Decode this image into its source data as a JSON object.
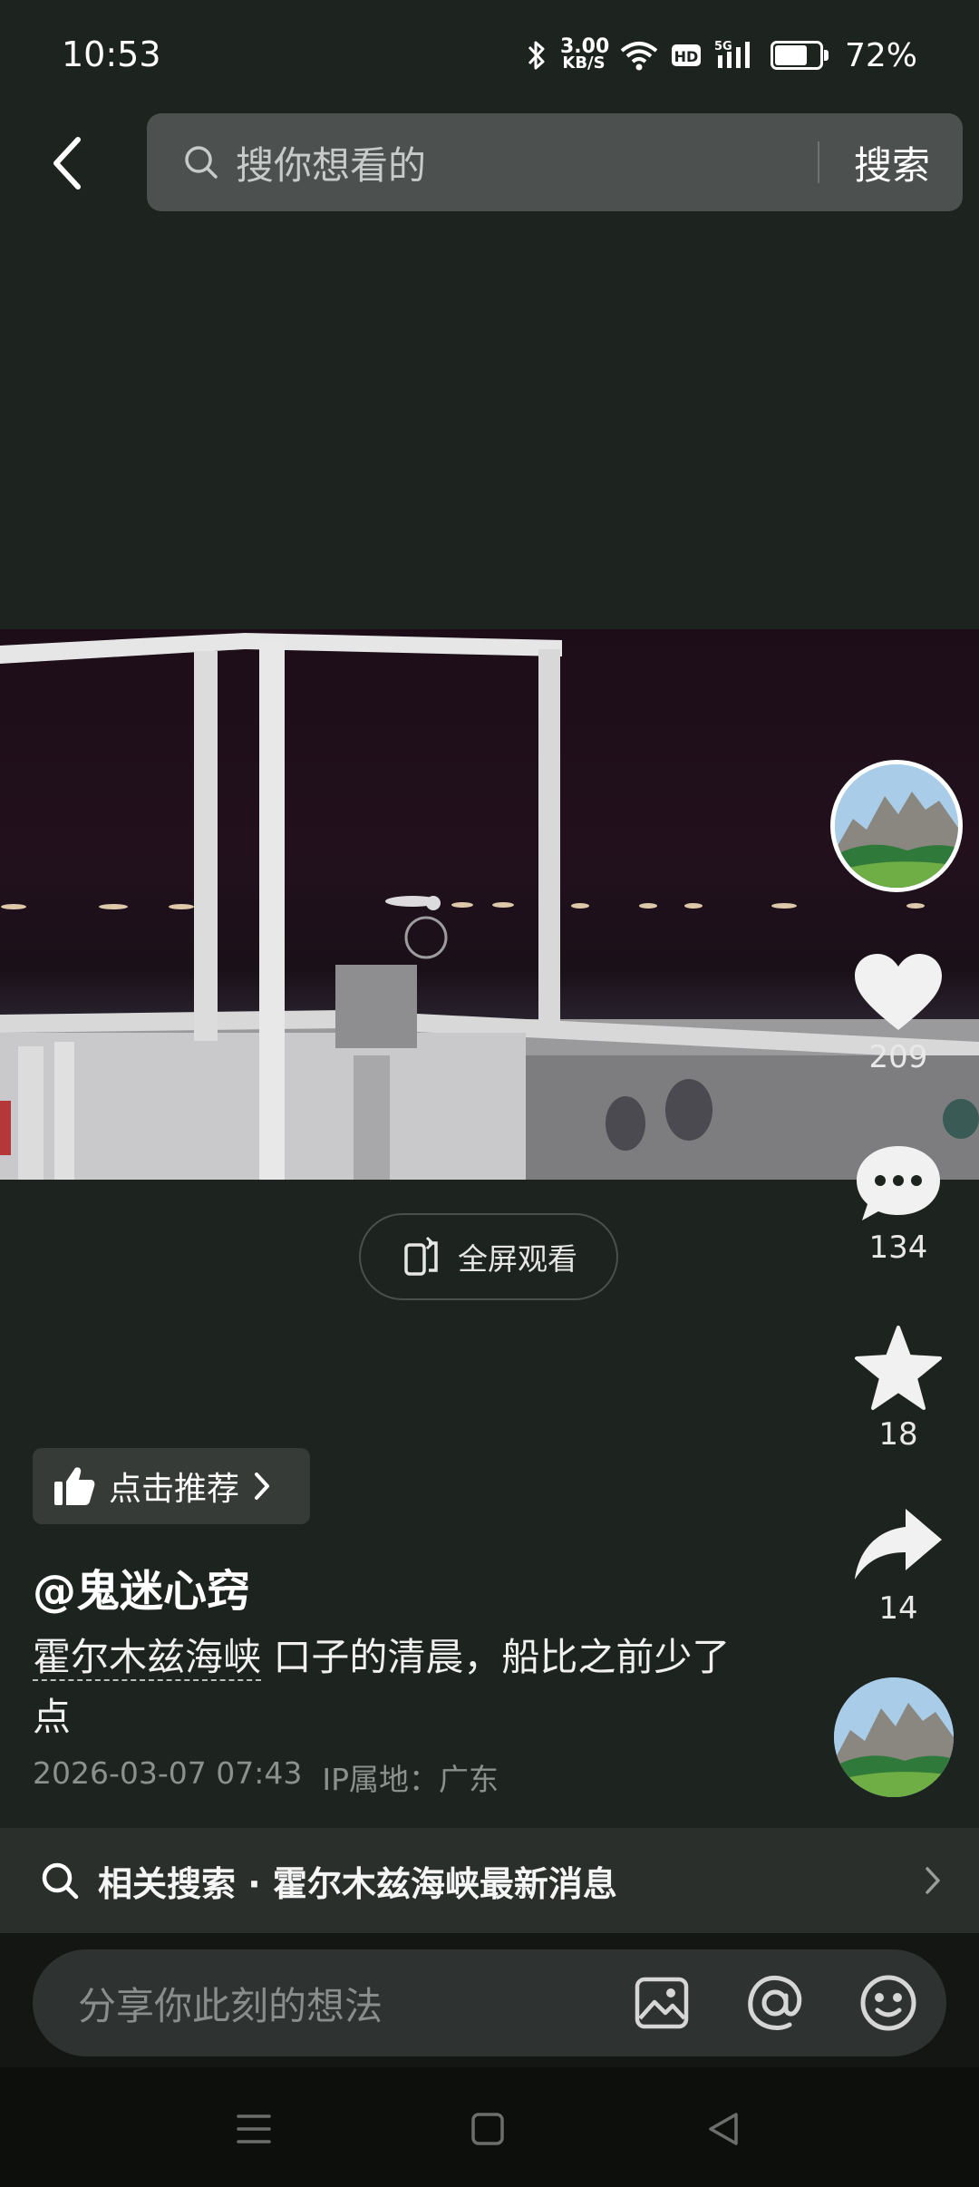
{
  "status_bar": {
    "time": "10:53",
    "net_speed_value": "3.00",
    "net_speed_unit": "KB/S",
    "hd_label": "HD",
    "network_label": "5G",
    "battery_percent": "72%",
    "battery_level": 0.72
  },
  "header": {
    "search_placeholder": "搜你想看的",
    "search_button": "搜索"
  },
  "video": {
    "fullscreen_label": "全屏观看"
  },
  "actions": {
    "likes": "209",
    "comments": "134",
    "favorites": "18",
    "shares": "14"
  },
  "post": {
    "recommend_label": "点击推荐",
    "username": "@鬼迷心窍",
    "topic": "霍尔木兹海峡",
    "caption": " 口子的清晨，船比之前少了点",
    "datetime": "2026-03-07 07:43",
    "ip_location": "IP属地：广东"
  },
  "related": {
    "text": "相关搜索 · 霍尔木兹海峡最新消息"
  },
  "comment": {
    "placeholder": "分享你此刻的想法"
  },
  "colors": {
    "background": "#1d231f",
    "search_box": "#4c514f",
    "related_bar": "#2a2f2c"
  }
}
